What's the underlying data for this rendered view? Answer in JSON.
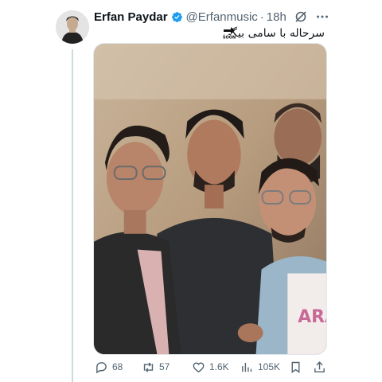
{
  "tweet": {
    "author_name": "Erfan Paydar",
    "handle": "@Erfanmusic",
    "separator": "·",
    "time": "18h",
    "text": "سرحاله با سامی بیگی",
    "emoji": "soon-arrow-emoji",
    "verified": true
  },
  "media": {
    "kind": "photo",
    "description_icon": "group-photo"
  },
  "actions": {
    "replies": "68",
    "retweets": "57",
    "likes": "1.6K",
    "views": "105K"
  },
  "colors": {
    "text": "#0f1419",
    "secondary": "#536471",
    "verified": "#1d9bf0",
    "thread_line": "#cfd9de"
  }
}
